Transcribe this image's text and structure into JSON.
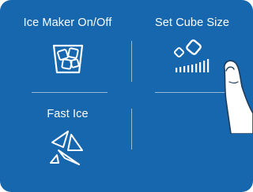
{
  "tiles": {
    "ice_maker": {
      "label": "Ice Maker On/Off",
      "icon": "ice-glass-icon"
    },
    "cube_size": {
      "label": "Set Cube Size",
      "icon": "cube-size-icon"
    },
    "fast_ice": {
      "label": "Fast Ice",
      "icon": "fast-ice-icon"
    }
  },
  "colors": {
    "panel_background": "#1667ae",
    "foreground": "#ffffff"
  }
}
